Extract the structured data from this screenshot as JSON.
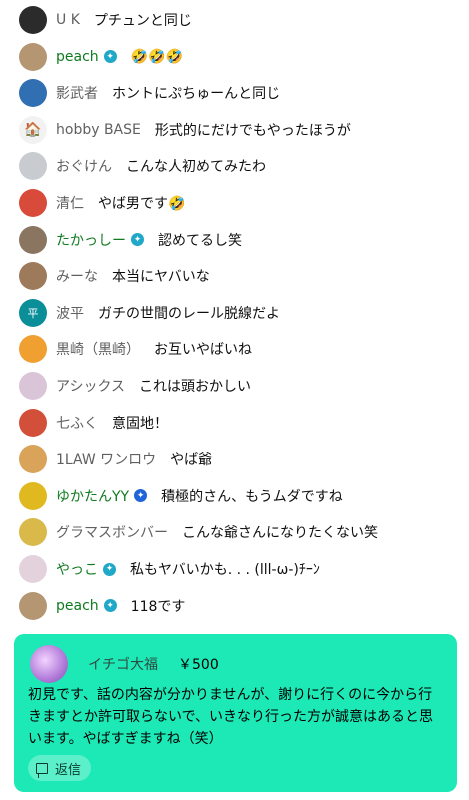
{
  "messages": [
    {
      "author": "U K",
      "text": "プチュンと同じ",
      "member": false,
      "avatar_color": "#2b2b2b",
      "avatar_glyph": ""
    },
    {
      "author": "peach",
      "text": "🤣🤣🤣",
      "member": true,
      "badge": "teal",
      "avatar_color": "#b49672",
      "avatar_glyph": ""
    },
    {
      "author": "影武者",
      "text": "ホントにぷちゅーんと同じ",
      "member": false,
      "avatar_color": "#2f6fb2",
      "avatar_glyph": ""
    },
    {
      "author": "hobby BASE",
      "text": "形式的にだけでもやったほうが",
      "member": false,
      "avatar_color": "#f2f2f2",
      "avatar_glyph": "🏠"
    },
    {
      "author": "おぐけん",
      "text": "こんな人初めてみたわ",
      "member": false,
      "avatar_color": "#c8ccd0",
      "avatar_glyph": ""
    },
    {
      "author": "清仁",
      "text": "やば男です🤣",
      "member": false,
      "avatar_color": "#d84a3a",
      "avatar_glyph": ""
    },
    {
      "author": "たかっしー",
      "text": "認めてるし笑",
      "member": true,
      "badge": "teal",
      "avatar_color": "#8a7560",
      "avatar_glyph": ""
    },
    {
      "author": "みーな",
      "text": "本当にヤバいな",
      "member": false,
      "avatar_color": "#9c7a5a",
      "avatar_glyph": ""
    },
    {
      "author": "波平",
      "text": "ガチの世間のレール脱線だよ",
      "member": false,
      "avatar_color": "#0a8f99",
      "avatar_glyph": "平"
    },
    {
      "author": "黒崎（黒崎）",
      "text": "お互いやばいね",
      "member": false,
      "avatar_color": "#f0a030",
      "avatar_glyph": ""
    },
    {
      "author": "アシックス",
      "text": "これは頭おかしい",
      "member": false,
      "avatar_color": "#d9c4d8",
      "avatar_glyph": ""
    },
    {
      "author": "七ふく",
      "text": "意固地！",
      "member": false,
      "avatar_color": "#d2503a",
      "avatar_glyph": ""
    },
    {
      "author": "1LAW ワンロウ",
      "text": "やば爺",
      "member": false,
      "avatar_color": "#d9a35a",
      "avatar_glyph": ""
    },
    {
      "author": "ゆかたんYY",
      "text": "積極的さん、もうムダですね",
      "member": true,
      "badge": "blue",
      "avatar_color": "#e0b820",
      "avatar_glyph": ""
    },
    {
      "author": "グラマスボンバー",
      "text": "こんな爺さんになりたくない笑",
      "member": false,
      "avatar_color": "#d8b94a",
      "avatar_glyph": ""
    },
    {
      "author": "やっこ",
      "text": "私もヤバいかも. . . (lll-ω-)ﾁｰﾝ",
      "member": true,
      "badge": "teal",
      "avatar_color": "#e3d2dc",
      "avatar_glyph": ""
    },
    {
      "author": "peach",
      "text": "118です",
      "member": true,
      "badge": "teal",
      "avatar_color": "#b49672",
      "avatar_glyph": ""
    }
  ],
  "superchat": {
    "author": "イチゴ大福",
    "amount": "￥500",
    "body": "初見です、話の内容が分かりませんが、謝りに行くのに今から行きますとか許可取らないで、いきなり行った方が誠意はあると思います。やばすぎますね（笑）",
    "reply_label": "返信",
    "background": "#1de9b6"
  }
}
